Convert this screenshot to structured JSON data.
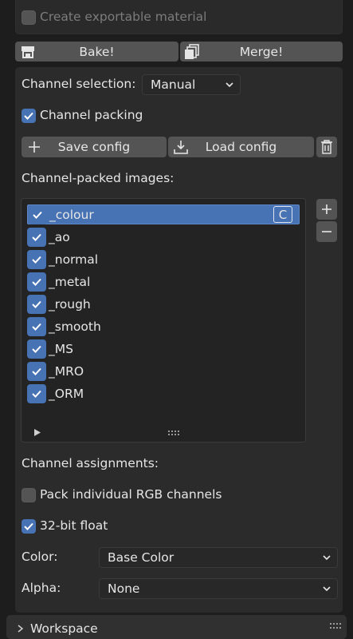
{
  "top": {
    "create_exportable_label": "Create exportable material"
  },
  "actions": {
    "bake_label": "Bake!",
    "merge_label": "Merge!"
  },
  "channel_selection": {
    "label": "Channel selection:",
    "value": "Manual"
  },
  "channel_packing": {
    "label": "Channel packing",
    "checked": true
  },
  "config": {
    "save_label": "Save config",
    "load_label": "Load config"
  },
  "packed_images": {
    "heading": "Channel-packed images:",
    "items": [
      {
        "label": "_colour",
        "checked": true,
        "selected": true,
        "badge": "C"
      },
      {
        "label": "_ao",
        "checked": true
      },
      {
        "label": "_normal",
        "checked": true
      },
      {
        "label": "_metal",
        "checked": true
      },
      {
        "label": "_rough",
        "checked": true
      },
      {
        "label": "_smooth",
        "checked": true
      },
      {
        "label": "_MS",
        "checked": true
      },
      {
        "label": "_MRO",
        "checked": true
      },
      {
        "label": "_ORM",
        "checked": true
      }
    ],
    "add_icon": "plus-icon",
    "remove_icon": "minus-icon"
  },
  "assignments": {
    "heading": "Channel assignments:",
    "pack_rgb_label": "Pack individual RGB channels",
    "float_label": "32-bit float",
    "color_label": "Color:",
    "color_value": "Base Color",
    "alpha_label": "Alpha:",
    "alpha_value": "None"
  },
  "footer": {
    "label": "Workspace"
  },
  "colors": {
    "accent": "#4772b3",
    "panel": "#2b2b2b",
    "button": "#545454",
    "background": "#1d1d1d"
  }
}
